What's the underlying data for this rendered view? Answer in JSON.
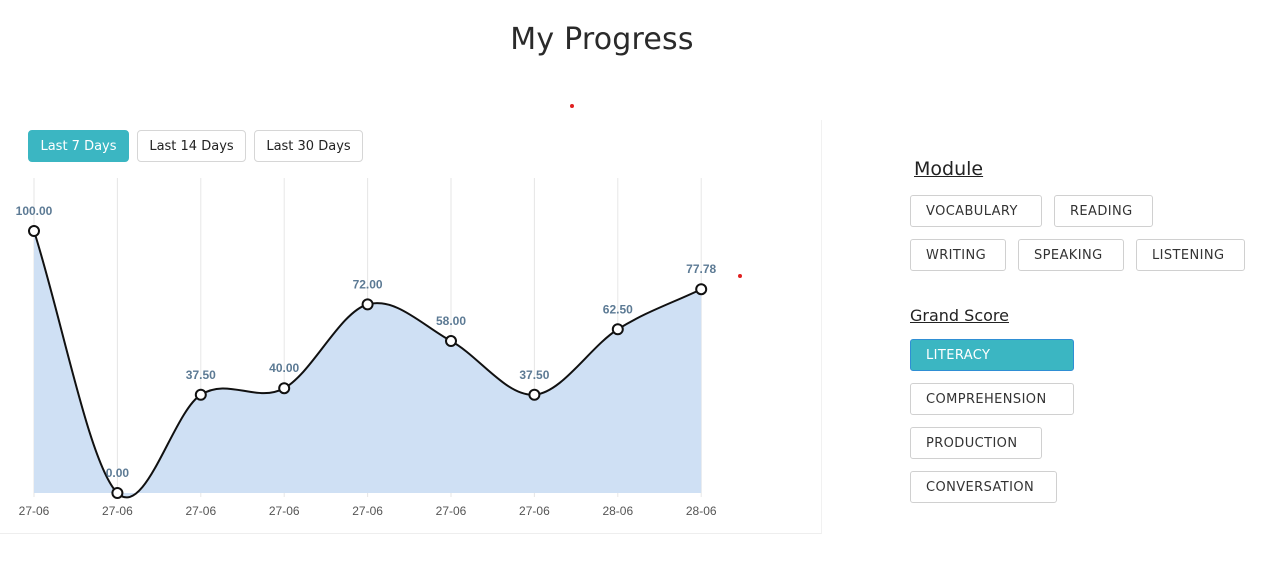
{
  "page": {
    "title": "My Progress"
  },
  "ranges": {
    "last7": "Last 7 Days",
    "last14": "Last 14 Days",
    "last30": "Last 30 Days"
  },
  "module": {
    "heading": "Module",
    "items": [
      "VOCABULARY",
      "READING",
      "WRITING",
      "SPEAKING",
      "LISTENING"
    ]
  },
  "grand_score": {
    "heading": "Grand Score",
    "items": [
      "LITERACY",
      "COMPREHENSION",
      "PRODUCTION",
      "CONVERSATION"
    ]
  },
  "colors": {
    "accent": "#3bb6c2",
    "area_fill": "#cfe0f4",
    "line": "#111111",
    "label": "#5c7a94",
    "marker": "#e02020"
  },
  "chart_data": {
    "type": "area",
    "categories": [
      "27-06",
      "27-06",
      "27-06",
      "27-06",
      "27-06",
      "27-06",
      "27-06",
      "28-06",
      "28-06"
    ],
    "values": [
      100.0,
      0.0,
      37.5,
      40.0,
      72.0,
      58.0,
      37.5,
      62.5,
      77.78
    ],
    "value_labels": [
      "100.00",
      "0.00",
      "37.50",
      "40.00",
      "72.00",
      "58.00",
      "37.50",
      "62.50",
      "77.78"
    ],
    "ylim": [
      0,
      100
    ],
    "grid": "vertical",
    "title": "",
    "xlabel": "",
    "ylabel": ""
  }
}
